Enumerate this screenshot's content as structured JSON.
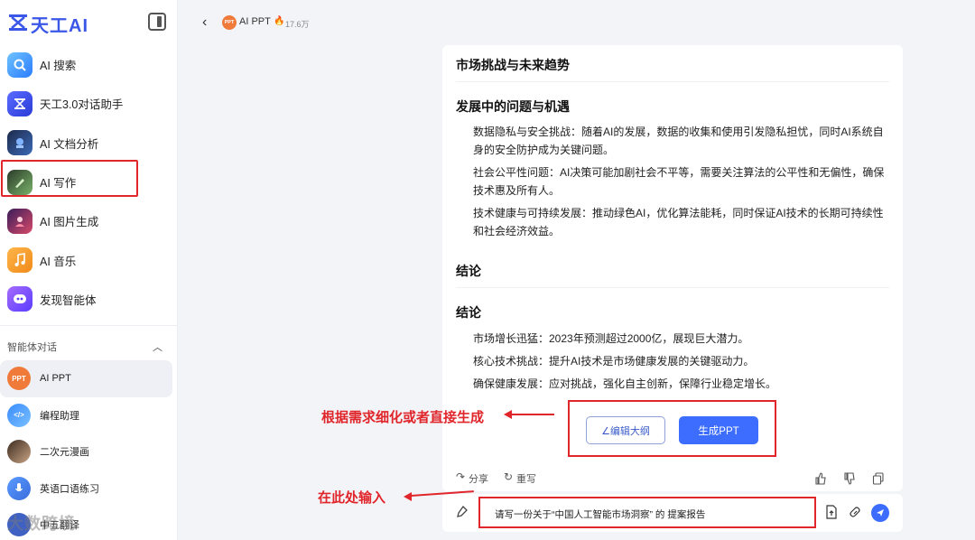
{
  "app": {
    "logo_text": "天工AI",
    "collapse_icon": "sidebar-collapse-icon"
  },
  "sidebar": {
    "items": [
      {
        "label": "AI 搜索",
        "icon": "search-icon"
      },
      {
        "label": "天工3.0对话助手",
        "icon": "chat-assistant-icon"
      },
      {
        "label": "AI 文档分析",
        "icon": "document-analysis-icon"
      },
      {
        "label": "AI 写作",
        "icon": "writing-icon"
      },
      {
        "label": "AI 图片生成",
        "icon": "image-generation-icon"
      },
      {
        "label": "AI 音乐",
        "icon": "music-icon"
      },
      {
        "label": "发现智能体",
        "icon": "agent-discover-icon"
      }
    ],
    "section_title": "智能体对话",
    "agents": [
      {
        "label": "AI PPT",
        "badge": "PPT",
        "active": true
      },
      {
        "label": "编程助理",
        "badge": "</>"
      },
      {
        "label": "二次元漫画",
        "badge": ""
      },
      {
        "label": "英语口语练习",
        "badge": ""
      },
      {
        "label": "中五翻译",
        "badge": ""
      }
    ],
    "watermark": "大数跨境"
  },
  "topbar": {
    "back_icon": "back-arrow-icon",
    "badge": "PPT",
    "title": "AI PPT",
    "hot_icon": "fire-icon",
    "hot_count": "17.6万"
  },
  "content": {
    "h1": "市场挑战与未来趋势",
    "h2": "发展中的问题与机遇",
    "paragraphs_1": [
      "数据隐私与安全挑战：随着AI的发展，数据的收集和使用引发隐私担忧，同时AI系统自身的安全防护成为关键问题。",
      "社会公平性问题：AI决策可能加剧社会不平等，需要关注算法的公平性和无偏性，确保技术惠及所有人。",
      "技术健康与可持续发展：推动绿色AI，优化算法能耗，同时保证AI技术的长期可持续性和社会经济效益。"
    ],
    "h3": "结论",
    "h4": "结论",
    "paragraphs_2": [
      "市场增长迅猛：2023年预测超过2000亿，展现巨大潜力。",
      "核心技术挑战：提升AI技术是市场健康发展的关键驱动力。",
      "确保健康发展：应对挑战，强化自主创新，保障行业稳定增长。"
    ],
    "edit_button": "∠编辑大纲",
    "generate_button": "生成PPT",
    "share_label": "分享",
    "rewrite_label": "重写"
  },
  "input": {
    "value": "请写一份关于“中国人工智能市场洞察” 的 提案报告"
  },
  "annotations": {
    "refine_text": "根据需求细化或者直接生成",
    "input_text": "在此处输入",
    "color": "#e0262b"
  }
}
